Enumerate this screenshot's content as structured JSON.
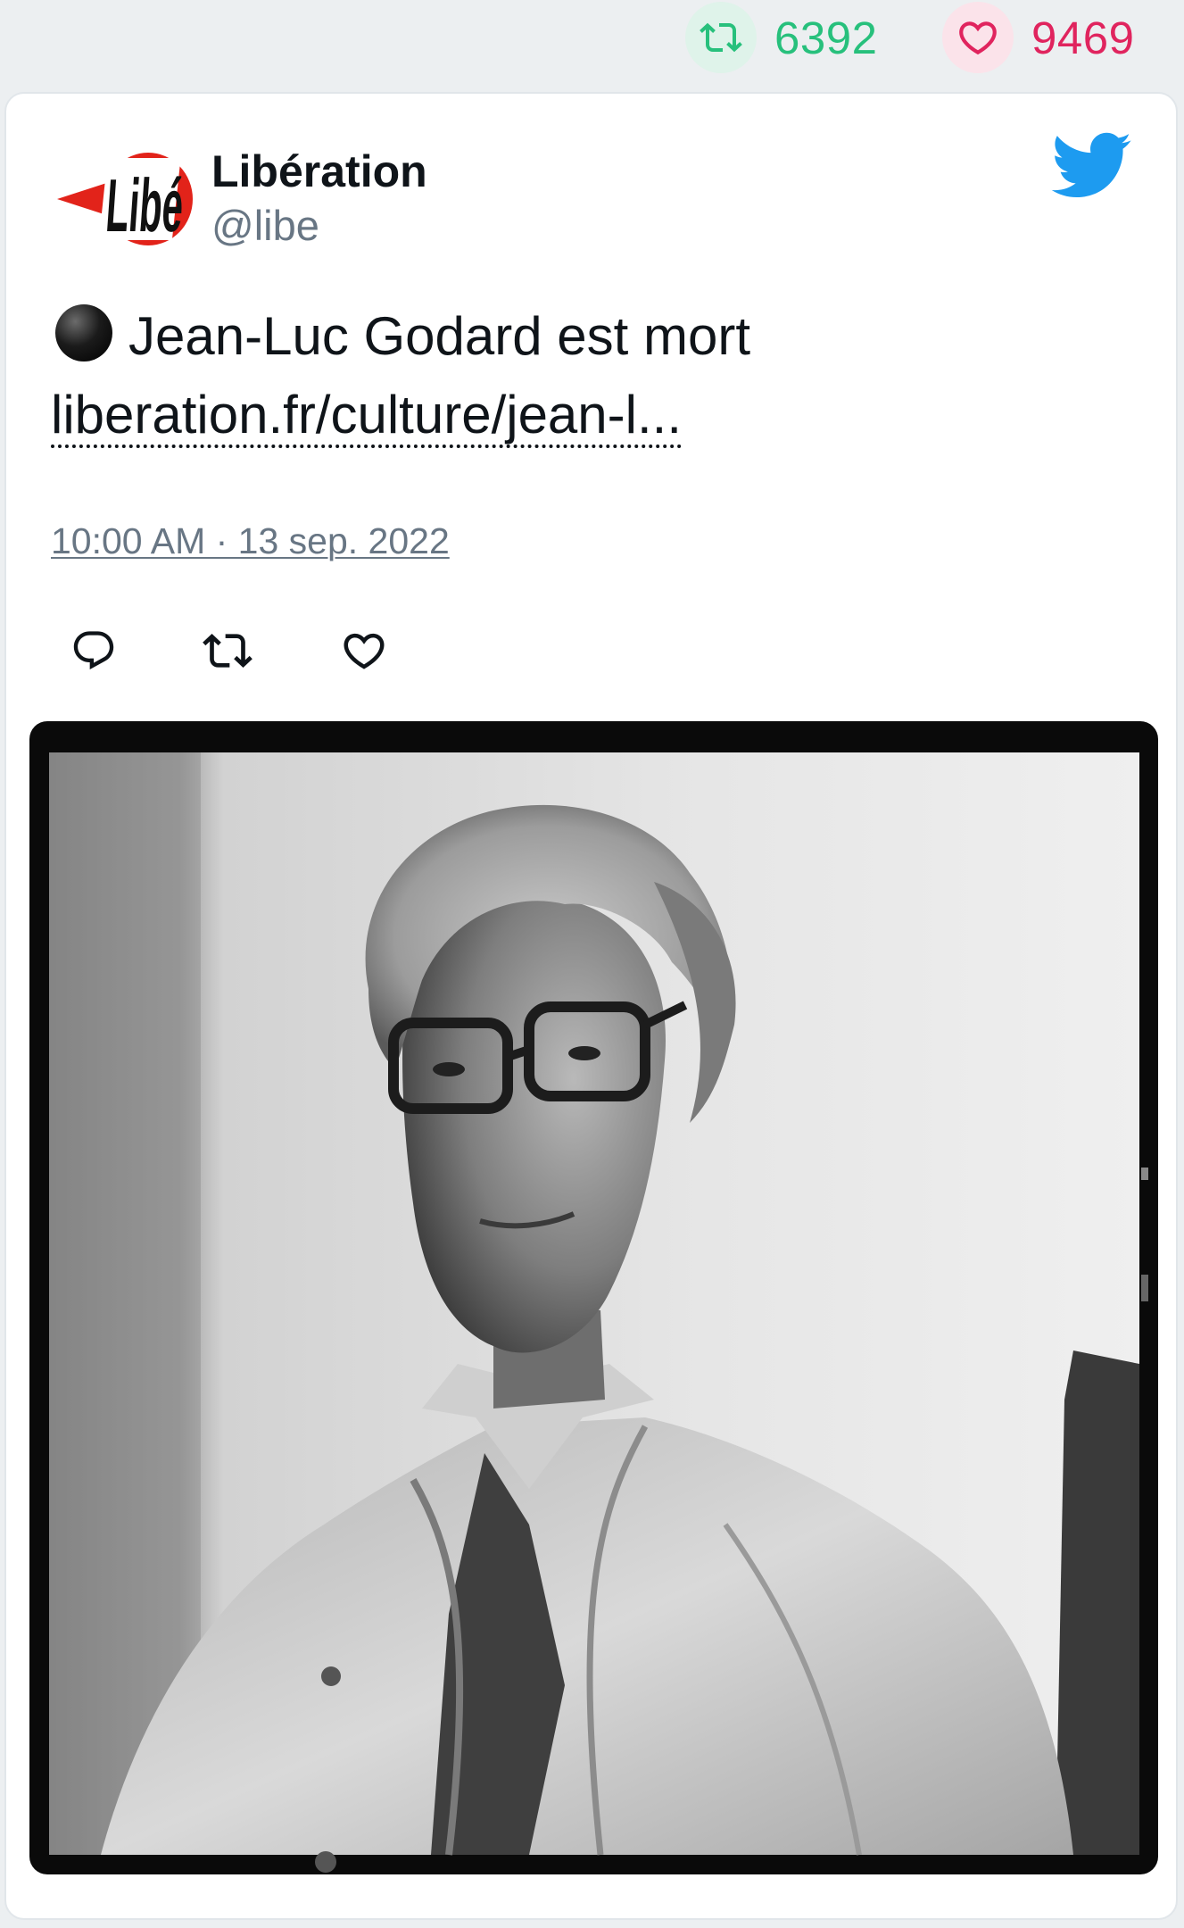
{
  "stats": {
    "retweets": "6392",
    "likes": "9469"
  },
  "author": {
    "name": "Libération",
    "handle": "@libe",
    "avatar_text": "Libé"
  },
  "tweet": {
    "emoji": "black-circle",
    "text": "Jean-Luc Godard est mort",
    "link": "liberation.fr/culture/jean-l...",
    "timestamp": "10:00 AM · 13 sep. 2022"
  },
  "colors": {
    "retweet_green": "#27c07c",
    "like_red": "#e0245e",
    "twitter_blue": "#1d9bf0",
    "handle_gray": "#687684"
  },
  "icons": {
    "retweet": "retweet-icon",
    "like": "heart-icon",
    "reply": "reply-icon",
    "brand": "twitter-bird-icon"
  },
  "photo": {
    "alt": ""
  }
}
